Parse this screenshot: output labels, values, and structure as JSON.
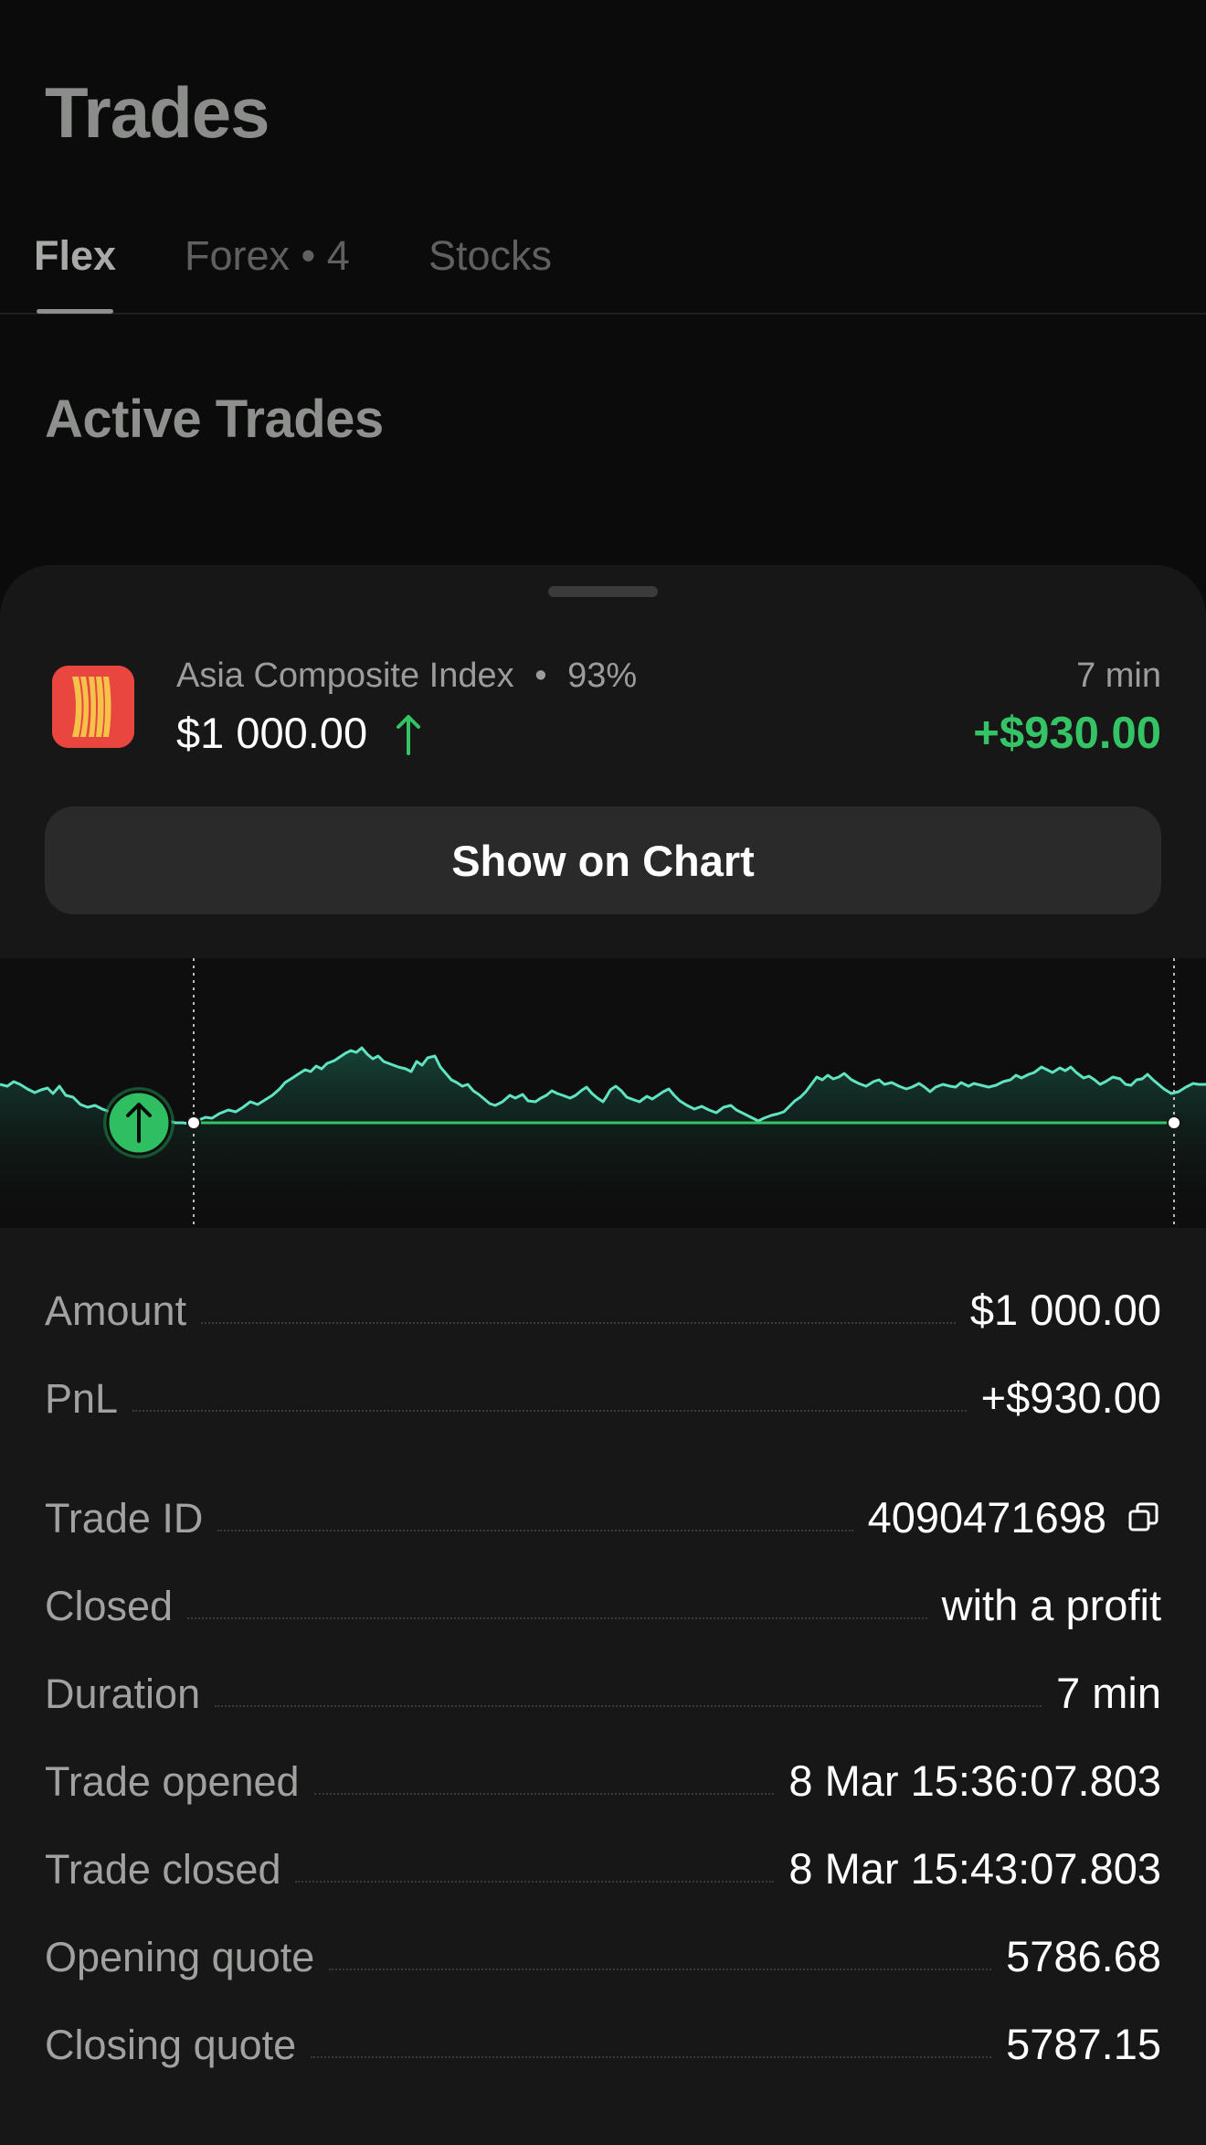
{
  "page": {
    "title": "Trades"
  },
  "tabs": [
    {
      "label": "Flex",
      "active": true
    },
    {
      "label": "Forex • 4",
      "active": false
    },
    {
      "label": "Stocks",
      "active": false
    }
  ],
  "section": {
    "title": "Active Trades"
  },
  "trade": {
    "asset": "Asia Composite Index",
    "separator": "•",
    "payout": "93%",
    "amount": "$1 000.00",
    "direction": "up",
    "duration": "7 min",
    "profit": "+$930.00",
    "show_chart_label": "Show on Chart"
  },
  "details": {
    "amount": {
      "label": "Amount",
      "value": "$1 000.00"
    },
    "pnl": {
      "label": "PnL",
      "value": "+$930.00"
    },
    "trade_id": {
      "label": "Trade ID",
      "value": "4090471698"
    },
    "closed": {
      "label": "Closed",
      "value": "with a profit"
    },
    "duration": {
      "label": "Duration",
      "value": "7 min"
    },
    "opened_at": {
      "label": "Trade opened",
      "value": "8 Mar 15:36:07.803"
    },
    "closed_at": {
      "label": "Trade closed",
      "value": "8 Mar 15:43:07.803"
    },
    "opening_quote": {
      "label": "Opening quote",
      "value": "5786.68"
    },
    "closing_quote": {
      "label": "Closing quote",
      "value": "5787.15"
    }
  },
  "colors": {
    "profit_green": "#34c466",
    "line_teal": "#5fe3c0",
    "icon_red": "#e8463f",
    "icon_gold": "#f6c34a"
  },
  "icons": {
    "asset": "asean-emblem-icon",
    "direction": "arrow-up-icon",
    "copy": "copy-icon"
  }
}
